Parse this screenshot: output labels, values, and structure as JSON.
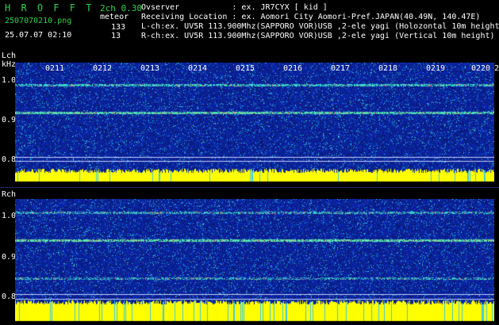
{
  "header": {
    "app_title": "H R O F F T",
    "mode": "2ch 0.30",
    "filename": "2507070210.png",
    "datetime": "25.07.07 02:10",
    "meteor_label": "meteor",
    "meteor_l_count": "133",
    "meteor_r_count": "13",
    "observer_line": "Ovserver           : ex. JR7CYX [ kid ]",
    "location_line": "Receiving Location : ex. Aomori City Aomori-Pref.JAPAN(40.49N, 140.47E)",
    "lch_line": "L-ch:ex. UV5R 113.900Mhz(SAPPORO VOR)USB ,2-ele yagi (Holozontal 10m height)",
    "rch_line": "R-ch:ex. UV5R 113.900Mhz(SAPPORO VOR)USB ,2-ele yagi (Vertical 10m height)"
  },
  "lch_panel": {
    "channel_label": "Lch",
    "unit_label": "kHz",
    "freq_ticks": [
      "1.0",
      "0.9",
      "0.8"
    ],
    "time_labels": [
      "0211",
      "0212",
      "0213",
      "0214",
      "0215",
      "0216",
      "0217",
      "0218",
      "0219",
      "0220",
      "2"
    ]
  },
  "rch_panel": {
    "channel_label": "Rch",
    "freq_ticks": [
      "1.0",
      "0.9",
      "0.8"
    ]
  },
  "colors": {
    "background": "#000000",
    "header_green": "#2ad24a",
    "spectrogram_blue": "#1a2ca0",
    "signal_cyan": "#40e0d0",
    "level_yellow": "#ffff00"
  }
}
